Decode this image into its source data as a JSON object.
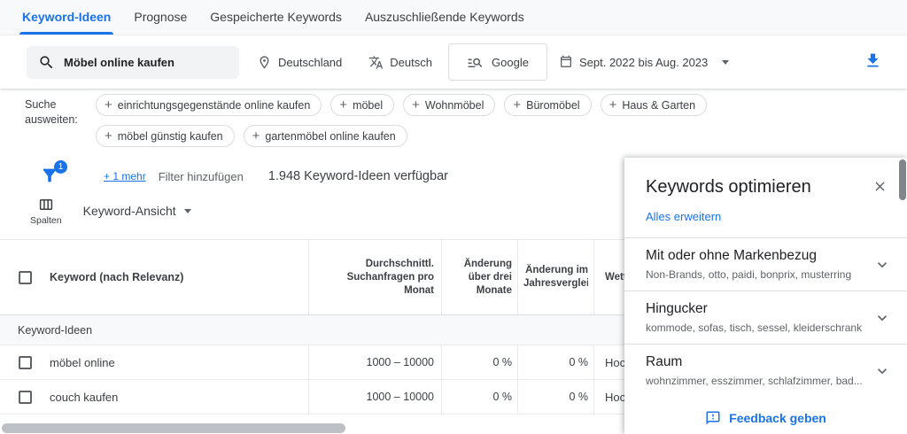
{
  "tabs": {
    "items": [
      {
        "label": "Keyword-Ideen"
      },
      {
        "label": "Prognose"
      },
      {
        "label": "Gespeicherte Keywords"
      },
      {
        "label": "Auszuschließende Keywords"
      }
    ]
  },
  "toolbar": {
    "search_value": "Möbel online kaufen",
    "location": "Deutschland",
    "language": "Deutsch",
    "network": "Google",
    "date_range": "Sept. 2022 bis Aug. 2023"
  },
  "expand_search": {
    "label": "Suche ausweiten:",
    "chips": [
      {
        "label": "einrichtungsgegenstände online kaufen"
      },
      {
        "label": "möbel"
      },
      {
        "label": "Wohnmöbel"
      },
      {
        "label": "Büromöbel"
      },
      {
        "label": "Haus & Garten"
      },
      {
        "label": "möbel günstig kaufen"
      },
      {
        "label": "gartenmöbel online kaufen"
      }
    ]
  },
  "filter_bar": {
    "filter_count_badge": "1",
    "more_filters_link": "+ 1 mehr",
    "add_filter_label": "Filter hinzufügen",
    "ideas_available": "1.948 Keyword-Ideen verfügbar"
  },
  "view_bar": {
    "columns_label": "Spalten",
    "view_selector": "Keyword-Ansicht"
  },
  "table": {
    "headers": {
      "keyword": "Keyword (nach Relevanz)",
      "avg_monthly_searches": "Durchschnittl. Suchanfragen pro Monat",
      "three_month_change": "Änderung über drei Monate",
      "yoy_change": "Änderung im Jahresvergleich",
      "competition": "Wettbewerb"
    },
    "section_label": "Keyword-Ideen",
    "rows": [
      {
        "keyword": "möbel online",
        "avg_monthly_searches": "1000 – 10000",
        "three_month_change": "0 %",
        "yoy_change": "0 %",
        "competition": "Hoch"
      },
      {
        "keyword": "couch kaufen",
        "avg_monthly_searches": "1000 – 10000",
        "three_month_change": "0 %",
        "yoy_change": "0 %",
        "competition": "Hoch"
      }
    ]
  },
  "panel": {
    "title": "Keywords optimieren",
    "expand_all": "Alles erweitern",
    "sections": [
      {
        "title": "Mit oder ohne Markenbezug",
        "subtitle": "Non-Brands, otto, paidi, bonprix, musterring"
      },
      {
        "title": "Hingucker",
        "subtitle": "kommode, sofas, tisch, sessel, kleiderschrank"
      },
      {
        "title": "Raum",
        "subtitle": "wohnzimmer, esszimmer, schlafzimmer, bad..."
      }
    ],
    "feedback_label": "Feedback geben"
  },
  "icons": {
    "chip_add": "+",
    "search": "magnifier",
    "location": "map-pin",
    "language": "translate",
    "network": "search-list",
    "date": "calendar",
    "download": "download-arrow-tray",
    "filter": "funnel",
    "columns": "column-grid",
    "close": "x",
    "chevron": "chevron-down",
    "feedback": "speech-bubble-exclamation"
  },
  "colors": {
    "accent": "#1a73e8",
    "text_primary": "#202124",
    "text_secondary": "#5f6368",
    "border": "#dadce0",
    "field_bg": "#f1f3f4"
  }
}
